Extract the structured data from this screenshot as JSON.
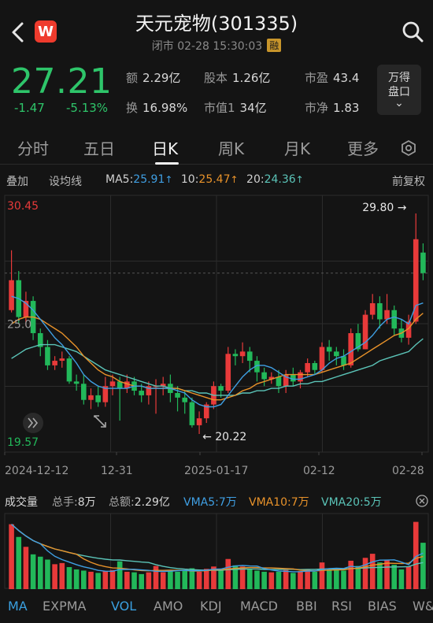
{
  "header": {
    "title": "天元宠物(301335)",
    "subtitle": "闭市  02-28  15:30:03",
    "badge": "融",
    "logo": "W"
  },
  "quote": {
    "price": "27.21",
    "change": "-1.47",
    "change_pct": "-5.13%",
    "stats": [
      {
        "label": "额",
        "value": "2.29亿"
      },
      {
        "label": "股本",
        "value": "1.26亿"
      },
      {
        "label": "市盈",
        "value": "43.4"
      },
      {
        "label": "换",
        "value": "16.98%"
      },
      {
        "label": "市值1",
        "value": "34亿"
      },
      {
        "label": "市净",
        "value": "1.83"
      }
    ],
    "wande_line1": "万得",
    "wande_line2": "盘口",
    "wande_chevron": "⌄"
  },
  "tabs": [
    "分时",
    "五日",
    "日K",
    "周K",
    "月K",
    "更多"
  ],
  "toolbar": {
    "overlay": "叠加",
    "ma_setting": "设均线",
    "ma5_label": "MA5:",
    "ma5_value": "25.91",
    "ma10_label": "10:",
    "ma10_value": "25.47",
    "ma20_label": "20:",
    "ma20_value": "24.36",
    "up_arrow": "↑",
    "adjust": "前复权"
  },
  "chart_data": {
    "type": "candlestick",
    "y_top_label": "30.45",
    "y_mid_label": "25.0",
    "y_bottom_label": "19.57",
    "ylim": [
      19.57,
      30.45
    ],
    "high_annotation": "29.80",
    "low_annotation": "20.22",
    "x_labels": [
      "2024-12-12",
      "12-31",
      "2025-01-17",
      "02-12",
      "02-28"
    ],
    "candles": [
      {
        "o": 25.6,
        "c": 26.9,
        "h": 28.2,
        "l": 25.5
      },
      {
        "o": 26.9,
        "c": 25.3,
        "h": 27.3,
        "l": 25.0
      },
      {
        "o": 25.3,
        "c": 26.0,
        "h": 26.4,
        "l": 24.9
      },
      {
        "o": 26.0,
        "c": 24.6,
        "h": 26.2,
        "l": 24.3
      },
      {
        "o": 24.6,
        "c": 24.0,
        "h": 24.8,
        "l": 23.6
      },
      {
        "o": 24.0,
        "c": 23.2,
        "h": 24.3,
        "l": 23.0
      },
      {
        "o": 23.2,
        "c": 23.4,
        "h": 23.6,
        "l": 23.0
      },
      {
        "o": 23.4,
        "c": 23.5,
        "h": 23.8,
        "l": 23.1
      },
      {
        "o": 23.5,
        "c": 22.5,
        "h": 23.6,
        "l": 22.4
      },
      {
        "o": 22.5,
        "c": 22.4,
        "h": 22.8,
        "l": 22.1
      },
      {
        "o": 22.4,
        "c": 21.7,
        "h": 22.8,
        "l": 21.5
      },
      {
        "o": 21.7,
        "c": 21.9,
        "h": 22.2,
        "l": 21.3
      },
      {
        "o": 21.9,
        "c": 21.6,
        "h": 22.3,
        "l": 21.4
      },
      {
        "o": 21.6,
        "c": 22.3,
        "h": 22.7,
        "l": 21.4
      },
      {
        "o": 22.3,
        "c": 22.5,
        "h": 22.8,
        "l": 21.9
      },
      {
        "o": 22.5,
        "c": 22.2,
        "h": 22.7,
        "l": 20.8
      },
      {
        "o": 22.2,
        "c": 22.5,
        "h": 22.8,
        "l": 22.0
      },
      {
        "o": 22.5,
        "c": 22.1,
        "h": 22.7,
        "l": 21.9
      },
      {
        "o": 22.1,
        "c": 21.9,
        "h": 22.4,
        "l": 21.6
      },
      {
        "o": 21.9,
        "c": 22.3,
        "h": 22.5,
        "l": 21.5
      },
      {
        "o": 22.3,
        "c": 22.3,
        "h": 22.6,
        "l": 21.1
      },
      {
        "o": 22.3,
        "c": 22.4,
        "h": 22.7,
        "l": 21.9
      },
      {
        "o": 22.4,
        "c": 22.0,
        "h": 22.8,
        "l": 21.6
      },
      {
        "o": 22.0,
        "c": 21.8,
        "h": 22.3,
        "l": 21.2
      },
      {
        "o": 21.8,
        "c": 21.6,
        "h": 22.1,
        "l": 21.1
      },
      {
        "o": 21.6,
        "c": 20.6,
        "h": 21.8,
        "l": 20.5
      },
      {
        "o": 20.6,
        "c": 20.9,
        "h": 21.2,
        "l": 20.22
      },
      {
        "o": 20.9,
        "c": 21.5,
        "h": 21.6,
        "l": 20.7
      },
      {
        "o": 21.5,
        "c": 22.3,
        "h": 22.5,
        "l": 21.3
      },
      {
        "o": 22.3,
        "c": 22.1,
        "h": 22.4,
        "l": 21.8
      },
      {
        "o": 22.1,
        "c": 23.7,
        "h": 24.0,
        "l": 22.0
      },
      {
        "o": 23.7,
        "c": 23.6,
        "h": 23.9,
        "l": 23.2
      },
      {
        "o": 23.6,
        "c": 23.8,
        "h": 24.2,
        "l": 23.3
      },
      {
        "o": 23.8,
        "c": 23.4,
        "h": 24.0,
        "l": 22.9
      },
      {
        "o": 23.4,
        "c": 22.9,
        "h": 23.6,
        "l": 22.5
      },
      {
        "o": 22.9,
        "c": 22.6,
        "h": 23.1,
        "l": 22.3
      },
      {
        "o": 22.6,
        "c": 22.7,
        "h": 22.9,
        "l": 22.4
      },
      {
        "o": 22.7,
        "c": 22.3,
        "h": 23.0,
        "l": 22.0
      },
      {
        "o": 22.3,
        "c": 22.8,
        "h": 23.0,
        "l": 22.0
      },
      {
        "o": 22.8,
        "c": 22.5,
        "h": 23.1,
        "l": 22.3
      },
      {
        "o": 22.5,
        "c": 22.9,
        "h": 23.0,
        "l": 22.2
      },
      {
        "o": 22.9,
        "c": 23.3,
        "h": 23.5,
        "l": 22.7
      },
      {
        "o": 23.3,
        "c": 23.0,
        "h": 23.4,
        "l": 22.8
      },
      {
        "o": 23.0,
        "c": 24.0,
        "h": 24.2,
        "l": 22.9
      },
      {
        "o": 24.0,
        "c": 23.8,
        "h": 24.3,
        "l": 23.4
      },
      {
        "o": 23.8,
        "c": 23.6,
        "h": 24.0,
        "l": 23.2
      },
      {
        "o": 23.6,
        "c": 23.2,
        "h": 23.9,
        "l": 23.0
      },
      {
        "o": 23.2,
        "c": 24.6,
        "h": 24.8,
        "l": 23.1
      },
      {
        "o": 24.6,
        "c": 23.9,
        "h": 25.0,
        "l": 23.8
      },
      {
        "o": 23.9,
        "c": 25.4,
        "h": 25.6,
        "l": 23.9
      },
      {
        "o": 25.4,
        "c": 25.9,
        "h": 26.3,
        "l": 25.2
      },
      {
        "o": 25.9,
        "c": 25.2,
        "h": 26.2,
        "l": 24.8
      },
      {
        "o": 25.2,
        "c": 25.6,
        "h": 26.3,
        "l": 25.0
      },
      {
        "o": 25.6,
        "c": 24.8,
        "h": 25.8,
        "l": 24.5
      },
      {
        "o": 24.8,
        "c": 24.4,
        "h": 25.2,
        "l": 24.2
      },
      {
        "o": 24.4,
        "c": 25.1,
        "h": 25.4,
        "l": 24.1
      },
      {
        "o": 25.1,
        "c": 28.68,
        "h": 29.8,
        "l": 25.0
      },
      {
        "o": 28.1,
        "c": 27.21,
        "h": 28.5,
        "l": 26.9
      }
    ],
    "ma5": [
      26.2,
      26.1,
      25.9,
      25.6,
      25.2,
      24.8,
      24.4,
      24.1,
      23.7,
      23.3,
      22.8,
      22.5,
      22.3,
      22.2,
      22.2,
      22.2,
      22.2,
      22.3,
      22.3,
      22.2,
      22.2,
      22.2,
      22.2,
      22.1,
      22.0,
      21.7,
      21.5,
      21.4,
      21.4,
      21.5,
      21.9,
      22.3,
      22.7,
      23.0,
      23.2,
      23.2,
      23.1,
      22.9,
      22.7,
      22.6,
      22.6,
      22.7,
      22.8,
      23.0,
      23.3,
      23.5,
      23.6,
      23.8,
      24.0,
      24.2,
      24.5,
      24.9,
      25.2,
      25.3,
      25.2,
      25.0,
      25.8,
      25.91
    ],
    "ma10": [
      25.0,
      25.2,
      25.3,
      25.3,
      25.2,
      25.0,
      24.8,
      24.6,
      24.3,
      24.0,
      23.6,
      23.3,
      23.0,
      22.8,
      22.7,
      22.5,
      22.4,
      22.3,
      22.3,
      22.2,
      22.2,
      22.2,
      22.2,
      22.2,
      22.1,
      22.0,
      21.9,
      21.8,
      21.7,
      21.7,
      21.8,
      21.9,
      22.1,
      22.2,
      22.4,
      22.5,
      22.6,
      22.7,
      22.8,
      22.8,
      22.8,
      22.8,
      22.8,
      22.9,
      23.0,
      23.1,
      23.2,
      23.3,
      23.5,
      23.7,
      23.9,
      24.1,
      24.3,
      24.5,
      24.6,
      24.8,
      25.2,
      25.47
    ],
    "ma20": [
      23.5,
      23.7,
      23.9,
      24.0,
      24.1,
      24.1,
      24.1,
      24.0,
      23.9,
      23.8,
      23.6,
      23.4,
      23.2,
      23.0,
      22.9,
      22.8,
      22.7,
      22.6,
      22.5,
      22.4,
      22.3,
      22.3,
      22.2,
      22.2,
      22.1,
      22.1,
      22.0,
      22.0,
      21.9,
      21.9,
      21.9,
      21.9,
      22.0,
      22.0,
      22.1,
      22.1,
      22.2,
      22.2,
      22.3,
      22.3,
      22.4,
      22.4,
      22.5,
      22.5,
      22.6,
      22.7,
      22.8,
      22.9,
      23.0,
      23.1,
      23.2,
      23.4,
      23.5,
      23.6,
      23.7,
      23.8,
      24.1,
      24.36
    ]
  },
  "volume": {
    "title": "成交量",
    "total_hands_label": "总手:",
    "total_hands": "8万",
    "total_amount_label": "总额:",
    "total_amount": "2.29亿",
    "vma5_label": "VMA5:",
    "vma5": "7万",
    "vma10_label": "VMA10:",
    "vma10": "7万",
    "vma20_label": "VMA20:",
    "vma20": "5万",
    "values": [
      11.2,
      9.0,
      7.3,
      6.0,
      5.6,
      5.1,
      4.3,
      4.5,
      3.8,
      3.4,
      3.2,
      3.0,
      2.8,
      3.1,
      3.3,
      4.8,
      3.0,
      2.9,
      2.6,
      2.9,
      4.0,
      2.9,
      3.1,
      3.0,
      3.2,
      3.6,
      3.0,
      3.5,
      3.9,
      3.3,
      5.2,
      4.1,
      3.9,
      3.5,
      3.2,
      3.0,
      2.9,
      3.0,
      3.3,
      2.8,
      3.1,
      3.4,
      3.0,
      4.6,
      3.6,
      3.4,
      3.2,
      4.9,
      4.0,
      5.4,
      6.1,
      4.6,
      5.0,
      4.2,
      3.4,
      3.9,
      11.6,
      8.0
    ]
  },
  "indicator_tabs": [
    "MA",
    "EXPMA",
    "VOL",
    "AMO",
    "KDJ",
    "MACD",
    "BBI",
    "RSI",
    "BIAS",
    "W&"
  ],
  "colors": {
    "up": "#e83a3a",
    "down": "#22b85a",
    "ma5": "#3f9fe3",
    "ma10": "#e8922a",
    "ma20": "#5bc4b8",
    "background": "#141414"
  }
}
